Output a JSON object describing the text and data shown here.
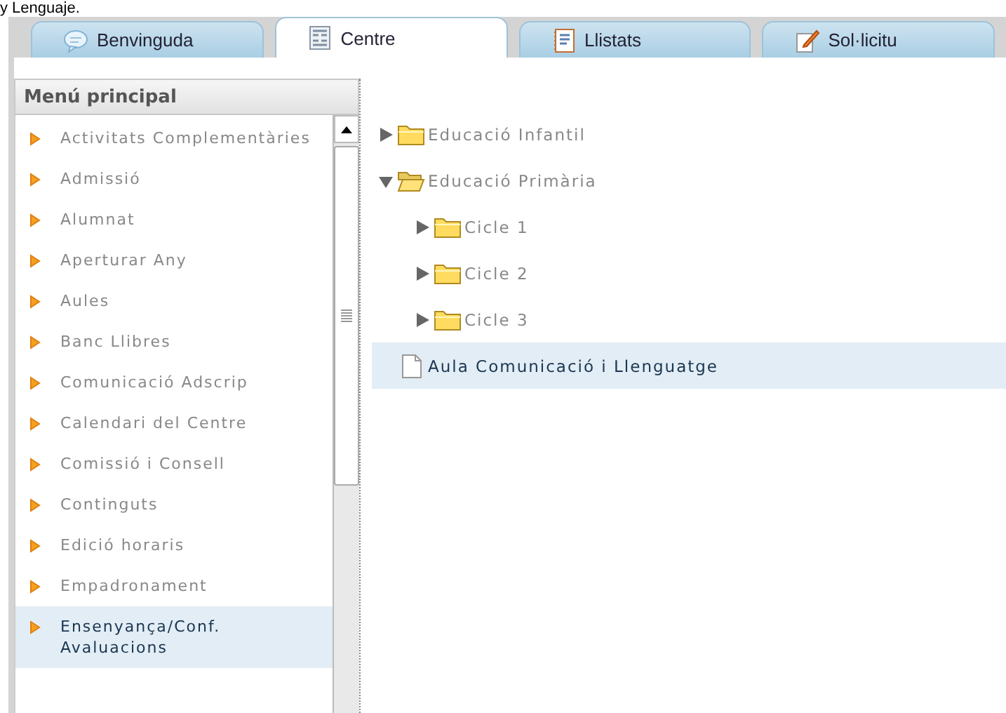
{
  "top_text": "y Lenguaje.",
  "tabs": [
    {
      "label": "Benvinguda",
      "kind": "chat",
      "selected": false
    },
    {
      "label": "Centre",
      "kind": "grid",
      "selected": true
    },
    {
      "label": "Llistats",
      "kind": "notebook",
      "selected": false
    },
    {
      "label": "Sol·licitu",
      "kind": "pencil",
      "selected": false
    }
  ],
  "sidebar": {
    "title": "Menú principal",
    "items": [
      {
        "label": "Activitats Complementàries",
        "selected": false
      },
      {
        "label": "Admissió",
        "selected": false
      },
      {
        "label": "Alumnat",
        "selected": false
      },
      {
        "label": "Aperturar Any",
        "selected": false
      },
      {
        "label": "Aules",
        "selected": false
      },
      {
        "label": "Banc Llibres",
        "selected": false
      },
      {
        "label": "Comunicació Adscrip",
        "selected": false
      },
      {
        "label": "Calendari del Centre",
        "selected": false
      },
      {
        "label": "Comissió i Consell",
        "selected": false
      },
      {
        "label": "Continguts",
        "selected": false
      },
      {
        "label": "Edició horaris",
        "selected": false
      },
      {
        "label": "Empadronament",
        "selected": false
      },
      {
        "label": "Ensenyança/Conf. Avaluacions",
        "selected": true
      }
    ]
  },
  "tree": [
    {
      "label": "Educació Infantil",
      "kind": "folder",
      "expanded": false,
      "selected": false
    },
    {
      "label": "Educació Primària",
      "kind": "folder",
      "expanded": true,
      "selected": false,
      "children": [
        {
          "label": "Cicle 1",
          "kind": "folder",
          "expanded": false,
          "selected": false
        },
        {
          "label": "Cicle 2",
          "kind": "folder",
          "expanded": false,
          "selected": false
        },
        {
          "label": "Cicle 3",
          "kind": "folder",
          "expanded": false,
          "selected": false
        }
      ]
    },
    {
      "label": "Aula Comunicació i Llenguatge",
      "kind": "file",
      "selected": true
    }
  ]
}
